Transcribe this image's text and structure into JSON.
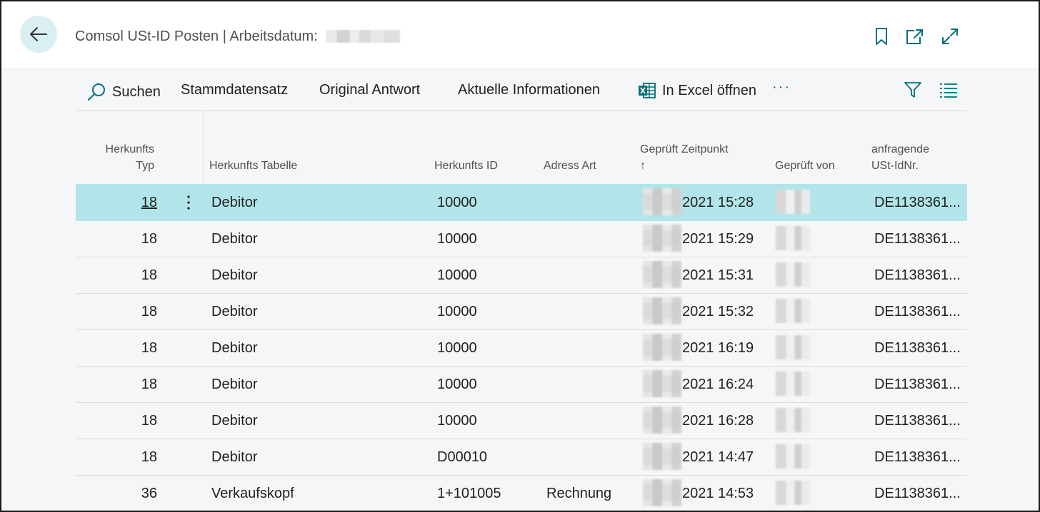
{
  "header": {
    "title": "Comsol USt-ID Posten | Arbeitsdatum:"
  },
  "toolbar": {
    "search": "Suchen",
    "stammdatensatz": "Stammdatensatz",
    "original_antwort": "Original Antwort",
    "aktuelle_informationen": "Aktuelle Informationen",
    "excel": "In Excel öffnen",
    "more": "···"
  },
  "columns": {
    "herkunfts_typ_1": "Herkunfts",
    "herkunfts_typ_2": "Typ",
    "herkunfts_tabelle": "Herkunfts Tabelle",
    "herkunfts_id": "Herkunfts ID",
    "adress_art": "Adress Art",
    "geprueft_zeitpunkt": "Geprüft Zeitpunkt",
    "sort_arrow": "↑",
    "geprueft_von": "Geprüft von",
    "ust_1": "anfragende",
    "ust_2": "USt-IdNr."
  },
  "rows": [
    {
      "typ": "18",
      "tabelle": "Debitor",
      "id": "10000",
      "art": "",
      "zeit": "2021 15:28",
      "ust": "DE1138361..."
    },
    {
      "typ": "18",
      "tabelle": "Debitor",
      "id": "10000",
      "art": "",
      "zeit": "2021 15:29",
      "ust": "DE1138361..."
    },
    {
      "typ": "18",
      "tabelle": "Debitor",
      "id": "10000",
      "art": "",
      "zeit": "2021 15:31",
      "ust": "DE1138361..."
    },
    {
      "typ": "18",
      "tabelle": "Debitor",
      "id": "10000",
      "art": "",
      "zeit": "2021 15:32",
      "ust": "DE1138361..."
    },
    {
      "typ": "18",
      "tabelle": "Debitor",
      "id": "10000",
      "art": "",
      "zeit": "2021 16:19",
      "ust": "DE1138361..."
    },
    {
      "typ": "18",
      "tabelle": "Debitor",
      "id": "10000",
      "art": "",
      "zeit": "2021 16:24",
      "ust": "DE1138361..."
    },
    {
      "typ": "18",
      "tabelle": "Debitor",
      "id": "10000",
      "art": "",
      "zeit": "2021 16:28",
      "ust": "DE1138361..."
    },
    {
      "typ": "18",
      "tabelle": "Debitor",
      "id": "D00010",
      "art": "",
      "zeit": "2021 14:47",
      "ust": "DE1138361..."
    },
    {
      "typ": "36",
      "tabelle": "Verkaufskopf",
      "id": "1+101005",
      "art": "Rechnung",
      "zeit": "2021 14:53",
      "ust": "DE1138361..."
    }
  ],
  "colors": {
    "accent": "#00707a",
    "selected_row": "#b1e5e9",
    "back_button": "#d9eff2"
  }
}
